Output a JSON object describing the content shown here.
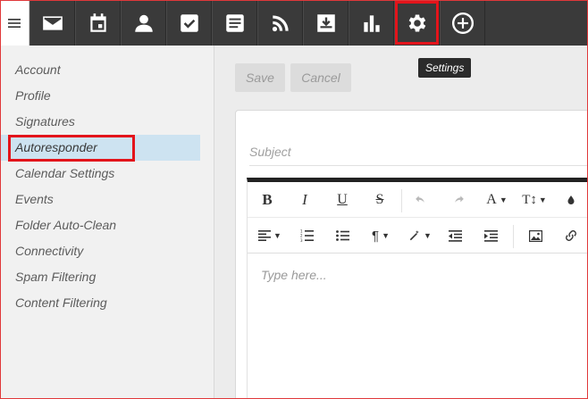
{
  "topbar": {
    "menu_icon": "hamburger-icon",
    "nav": [
      {
        "icon": "mail-icon"
      },
      {
        "icon": "calendar-icon"
      },
      {
        "icon": "contacts-icon"
      },
      {
        "icon": "tasks-icon"
      },
      {
        "icon": "notes-icon"
      },
      {
        "icon": "rss-icon"
      },
      {
        "icon": "download-icon"
      },
      {
        "icon": "chart-icon"
      },
      {
        "icon": "gear-icon",
        "active": true
      },
      {
        "icon": "add-circle-icon"
      }
    ],
    "tooltip": "Settings"
  },
  "sidebar": {
    "items": [
      {
        "label": "Account"
      },
      {
        "label": "Profile"
      },
      {
        "label": "Signatures"
      },
      {
        "label": "Autoresponder",
        "selected": true
      },
      {
        "label": "Calendar Settings"
      },
      {
        "label": "Events"
      },
      {
        "label": "Folder Auto-Clean"
      },
      {
        "label": "Connectivity"
      },
      {
        "label": "Spam Filtering"
      },
      {
        "label": "Content Filtering"
      }
    ]
  },
  "main": {
    "save_label": "Save",
    "cancel_label": "Cancel",
    "subject_placeholder": "Subject",
    "editor_placeholder": "Type here..."
  },
  "toolbar": {
    "bold": "B",
    "italic": "I",
    "underline": "U",
    "strike": "S",
    "font_a": "A",
    "text_size": "T↕"
  },
  "colors": {
    "topbar_bg": "#3a3a3a",
    "highlight_red": "#e3141b",
    "selected_bg": "#cde3f1"
  }
}
